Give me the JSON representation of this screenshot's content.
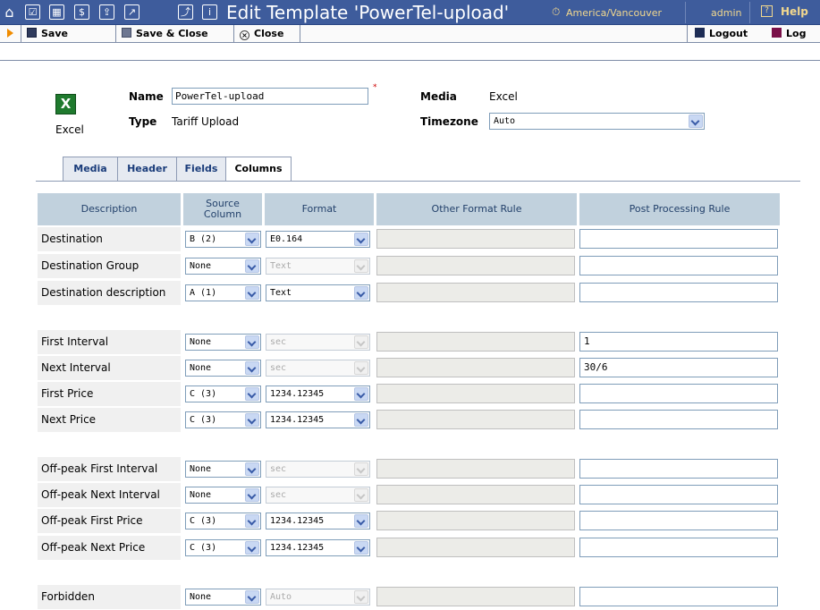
{
  "window": {
    "title": "Edit Template 'PowerTel-upload'",
    "timezone_link": "America/Vancouver",
    "user": "admin",
    "help": "Help",
    "colors": {
      "title_bar": "#3e5c9c",
      "header_cell": "#c1d1dd",
      "link_accent": "#f2d88e"
    }
  },
  "toolbar": {
    "save": "Save",
    "save_close": "Save & Close",
    "close": "Close",
    "logout": "Logout",
    "log": "Log"
  },
  "form": {
    "name_label": "Name",
    "name_value": "PowerTel-upload",
    "type_label": "Type",
    "type_value": "Tariff Upload",
    "media_label": "Media",
    "media_value": "Excel",
    "timezone_label": "Timezone",
    "timezone_value": "Auto",
    "icon_caption": "Excel"
  },
  "tabs": [
    "Media",
    "Header",
    "Fields",
    "Columns"
  ],
  "active_tab": "Columns",
  "table": {
    "headers": {
      "description": "Description",
      "source_column": "Source Column",
      "format": "Format",
      "other_format_rule": "Other Format Rule",
      "post_processing_rule": "Post Processing Rule"
    },
    "rows": [
      {
        "label": "Destination",
        "source": "B (2)",
        "format": "E0.164",
        "format_enabled": true,
        "post": ""
      },
      {
        "label": "Destination Group",
        "source": "None",
        "format": "Text",
        "format_enabled": false,
        "post": ""
      },
      {
        "label": "Destination description",
        "source": "A (1)",
        "format": "Text",
        "format_enabled": true,
        "post": ""
      },
      {
        "label": "First Interval",
        "source": "None",
        "format": "sec",
        "format_enabled": false,
        "post": "1"
      },
      {
        "label": "Next Interval",
        "source": "None",
        "format": "sec",
        "format_enabled": false,
        "post": "30/6"
      },
      {
        "label": "First Price",
        "source": "C (3)",
        "format": "1234.12345",
        "format_enabled": true,
        "post": ""
      },
      {
        "label": "Next Price",
        "source": "C (3)",
        "format": "1234.12345",
        "format_enabled": true,
        "post": ""
      },
      {
        "label": "Off-peak First Interval",
        "source": "None",
        "format": "sec",
        "format_enabled": false,
        "post": ""
      },
      {
        "label": "Off-peak Next Interval",
        "source": "None",
        "format": "sec",
        "format_enabled": false,
        "post": ""
      },
      {
        "label": "Off-peak First Price",
        "source": "C (3)",
        "format": "1234.12345",
        "format_enabled": true,
        "post": ""
      },
      {
        "label": "Off-peak Next Price",
        "source": "C (3)",
        "format": "1234.12345",
        "format_enabled": true,
        "post": ""
      },
      {
        "label": "Forbidden",
        "source": "None",
        "format": "Auto",
        "format_enabled": false,
        "post": ""
      }
    ]
  }
}
